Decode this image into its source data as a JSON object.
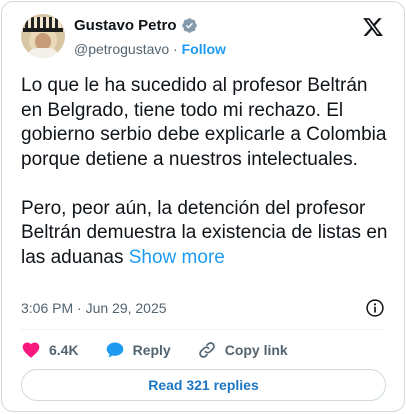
{
  "author": {
    "name": "Gustavo Petro",
    "handle": "@petrogustavo",
    "separator": "·",
    "follow_label": "Follow"
  },
  "tweet": {
    "paragraph_1": "Lo que le ha sucedido al profesor Beltrán en Belgrado, tiene todo mi rechazo. El gobierno serbio debe explicarle a Colombia porque detiene a nuestros intelectuales.",
    "paragraph_2": "Pero, peor aún, la detención del profesor Beltrán demuestra la existencia de listas en las aduanas",
    "show_more_label": "Show more"
  },
  "meta": {
    "timestamp": "3:06 PM · Jun 29, 2025"
  },
  "actions": {
    "likes": "6.4K",
    "reply_label": "Reply",
    "copy_link_label": "Copy link"
  },
  "replies_button_label": "Read 321 replies",
  "colors": {
    "accent": "#1d9bf0",
    "like": "#f91880",
    "reply_bubble": "#1d9bf0",
    "text": "#0f1419",
    "muted": "#536471",
    "border": "#cfd9de"
  },
  "icons": [
    "avatar",
    "verified-badge-icon",
    "x-logo-icon",
    "info-icon",
    "heart-icon",
    "reply-bubble-icon",
    "link-icon"
  ]
}
